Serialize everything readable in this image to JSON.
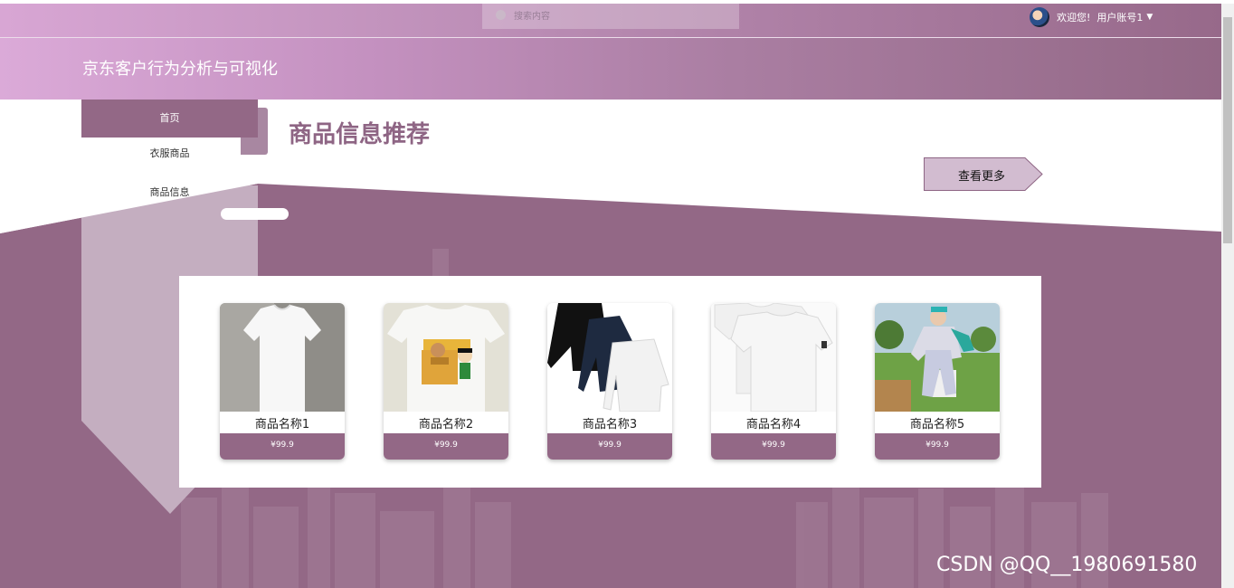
{
  "topbar": {
    "search_placeholder": "搜索内容",
    "welcome": "欢迎您!",
    "account": "用户账号1",
    "caret": "▼"
  },
  "header": {
    "title": "京东客户行为分析与可视化"
  },
  "sidebar": {
    "items": [
      {
        "label": "首页",
        "active": true
      },
      {
        "label": "衣服商品",
        "active": false
      },
      {
        "label": "商品信息",
        "active": false
      }
    ]
  },
  "main": {
    "section_title": "商品信息推荐",
    "more_button": "查看更多",
    "products": [
      {
        "name": "商品名称1",
        "price": "¥99.9",
        "image": "white-tshirt-icon"
      },
      {
        "name": "商品名称2",
        "price": "¥99.9",
        "image": "cartoon-tshirt-icon"
      },
      {
        "name": "商品名称3",
        "price": "¥99.9",
        "image": "long-sleeve-set-icon"
      },
      {
        "name": "商品名称4",
        "price": "¥99.9",
        "image": "white-tshirt-pair-icon"
      },
      {
        "name": "商品名称5",
        "price": "¥99.9",
        "image": "kids-outfit-photo-icon"
      }
    ]
  },
  "watermark": "CSDN @QQ__1980691580",
  "colors": {
    "brand": "#936886",
    "accent_light": "#d8a6d4",
    "panel": "#ffffff"
  }
}
